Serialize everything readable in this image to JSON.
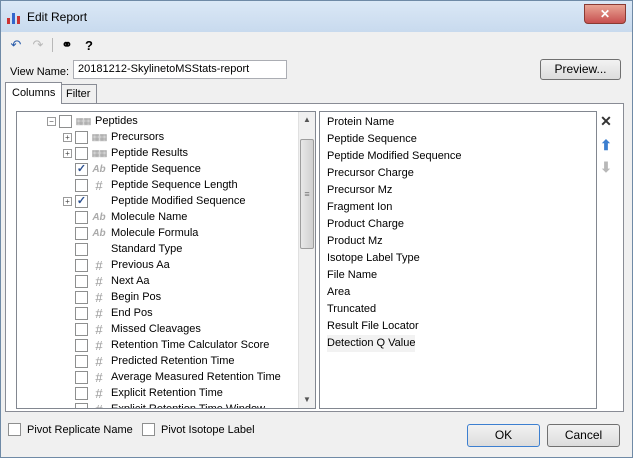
{
  "window": {
    "title": "Edit Report",
    "close_label": "✕"
  },
  "toolbar": {
    "undo": "↶",
    "redo": "↷",
    "find": "⚭",
    "help": "?"
  },
  "view": {
    "label": "View Name:",
    "value": "20181212-SkylinetoMSStats-report"
  },
  "buttons": {
    "preview": "Preview...",
    "ok": "OK",
    "cancel": "Cancel"
  },
  "tabs": [
    {
      "label": "Columns"
    },
    {
      "label": "Filter"
    }
  ],
  "tree": {
    "root": {
      "label": "Peptides",
      "expander": "−"
    },
    "items": [
      {
        "label": "Precursors",
        "expander": "+",
        "checked": "",
        "icon": "table"
      },
      {
        "label": "Peptide Results",
        "expander": "+",
        "checked": "",
        "icon": "table"
      },
      {
        "label": "Peptide Sequence",
        "expander": "",
        "checked": "✓",
        "icon": "Ab"
      },
      {
        "label": "Peptide Sequence Length",
        "expander": "",
        "checked": "",
        "icon": "#"
      },
      {
        "label": "Peptide Modified Sequence",
        "expander": "+",
        "checked": "✓",
        "icon": ""
      },
      {
        "label": "Molecule Name",
        "expander": "",
        "checked": "",
        "icon": "Ab"
      },
      {
        "label": "Molecule Formula",
        "expander": "",
        "checked": "",
        "icon": "Ab"
      },
      {
        "label": "Standard Type",
        "expander": "",
        "checked": "",
        "icon": ""
      },
      {
        "label": "Previous Aa",
        "expander": "",
        "checked": "",
        "icon": "#"
      },
      {
        "label": "Next Aa",
        "expander": "",
        "checked": "",
        "icon": "#"
      },
      {
        "label": "Begin Pos",
        "expander": "",
        "checked": "",
        "icon": "#"
      },
      {
        "label": "End Pos",
        "expander": "",
        "checked": "",
        "icon": "#"
      },
      {
        "label": "Missed Cleavages",
        "expander": "",
        "checked": "",
        "icon": "#"
      },
      {
        "label": "Retention Time Calculator Score",
        "expander": "",
        "checked": "",
        "icon": "#"
      },
      {
        "label": "Predicted Retention Time",
        "expander": "",
        "checked": "",
        "icon": "#"
      },
      {
        "label": "Average Measured Retention Time",
        "expander": "",
        "checked": "",
        "icon": "#"
      },
      {
        "label": "Explicit Retention Time",
        "expander": "",
        "checked": "",
        "icon": "#"
      },
      {
        "label": "Explicit Retention Time Window",
        "expander": "",
        "checked": "",
        "icon": "#"
      }
    ],
    "scroll": {
      "up": "▲",
      "down": "▼",
      "grip": "≡"
    }
  },
  "columns": [
    "Protein Name",
    "Peptide Sequence",
    "Peptide Modified Sequence",
    "Precursor Charge",
    "Precursor Mz",
    "Fragment Ion",
    "Product Charge",
    "Product Mz",
    "Isotope Label Type",
    "File Name",
    "Area",
    "Truncated",
    "Result File Locator",
    "Detection Q Value"
  ],
  "side_buttons": {
    "remove": "✕",
    "up": "⬆",
    "down": "⬇"
  },
  "bottom": {
    "pivot_replicate": "Pivot Replicate Name",
    "pivot_isotope": "Pivot Isotope Label"
  },
  "colors": {
    "accent": "#3c7fd0",
    "selection": "#f2f2f2",
    "disabled": "#b8b8b8"
  }
}
